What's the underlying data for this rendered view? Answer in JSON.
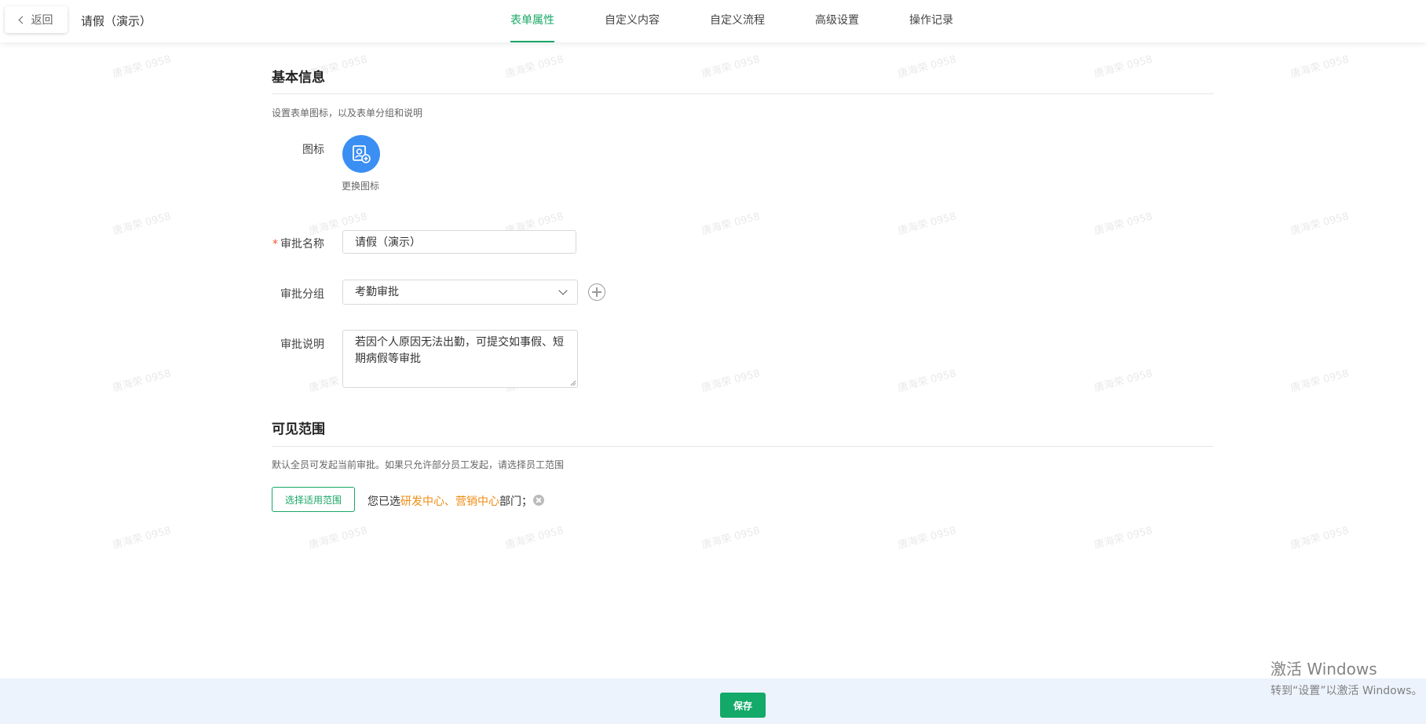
{
  "header": {
    "back_label": "返回",
    "title": "请假（演示）",
    "tabs": [
      {
        "label": "表单属性",
        "active": true
      },
      {
        "label": "自定义内容",
        "active": false
      },
      {
        "label": "自定义流程",
        "active": false
      },
      {
        "label": "高级设置",
        "active": false
      },
      {
        "label": "操作记录",
        "active": false
      }
    ]
  },
  "watermark_text": "唐海荣 0958",
  "basic_info": {
    "title": "基本信息",
    "description": "设置表单图标，以及表单分组和说明",
    "icon_label": "图标",
    "icon_name": "form-edit-icon",
    "change_icon_label": "更换图标",
    "name_label": "审批名称",
    "required_marker": "*",
    "name_value": "请假（演示）",
    "group_label": "审批分组",
    "group_value": "考勤审批",
    "desc_label": "审批说明",
    "desc_value": "若因个人原因无法出勤，可提交如事假、短期病假等审批"
  },
  "visibility": {
    "title": "可见范围",
    "description": "默认全员可发起当前审批。如果只允许部分员工发起，请选择员工范围",
    "select_button": "选择适用范围",
    "selected_prefix": "您已选",
    "selected_dept_1": "研发中心",
    "separator": "、",
    "selected_dept_2": "营销中心",
    "selected_suffix": "部门；"
  },
  "footer": {
    "save_label": "保存"
  },
  "windows_activation": {
    "line1": "激活 Windows",
    "line2": "转到“设置”以激活 Windows。"
  },
  "colors": {
    "accent": "#18a866",
    "icon_bg": "#3b8ff3",
    "dept_highlight": "#f08c12",
    "footer_bg": "#edf3fc"
  }
}
